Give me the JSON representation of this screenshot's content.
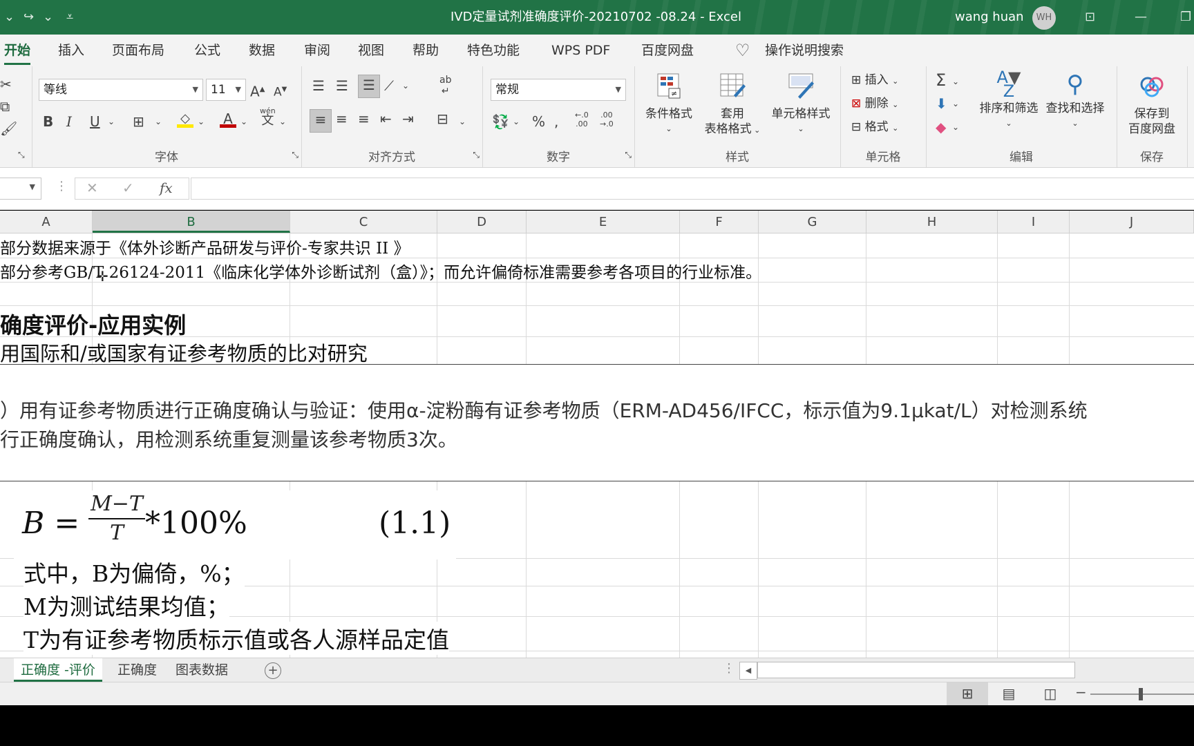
{
  "titlebar": {
    "title": "IVD定量试剂准确度评价-20210702 -08.24  -  Excel",
    "user_name": "wang huan",
    "user_initials": "WH"
  },
  "tabs": [
    "开始",
    "插入",
    "页面布局",
    "公式",
    "数据",
    "审阅",
    "视图",
    "帮助",
    "特色功能",
    "WPS PDF",
    "百度网盘"
  ],
  "tell_me": "操作说明搜索",
  "ribbon": {
    "font": {
      "name": "等线",
      "size": "11",
      "label": "字体",
      "wen_label": "wén"
    },
    "alignment": {
      "label": "对齐方式"
    },
    "number": {
      "format": "常规",
      "label": "数字"
    },
    "styles": {
      "conditional": "条件格式",
      "table_l1": "套用",
      "table_l2": "表格格式",
      "cell_styles": "单元格样式",
      "label": "样式"
    },
    "cells": {
      "insert": "插入",
      "delete": "删除",
      "format": "格式",
      "label": "单元格"
    },
    "editing": {
      "sort": "排序和筛选",
      "find": "查找和选择",
      "label": "编辑"
    },
    "save": {
      "l1": "保存到",
      "l2": "百度网盘",
      "label": "保存"
    }
  },
  "columns": [
    "A",
    "B",
    "C",
    "D",
    "E",
    "F",
    "G",
    "H",
    "I",
    "J"
  ],
  "selected_column": "B",
  "cells": {
    "r1": "部分数据来源于《体外诊断产品研发与评价-专家共识 II 》",
    "r2": "部分参考GB/T 26124-2011《临床化学体外诊断试剂（盒）》；而允许偏倚标准需要参考各项目的行业标准。",
    "r3": "确度评价-应用实例",
    "r4": "用国际和/或国家有证参考物质的比对研究",
    "r5a": "）用有证参考物质进行正确度确认与验证：使用α-淀粉酶有证参考物质（ERM-AD456/IFCC，标示值为9.1μkat/L）对检测系统",
    "r5b": "行正确度确认，用检测系统重复测量该参考物质3次。",
    "formula_lhs": "B =",
    "formula_num": "M−T",
    "formula_den": "T",
    "formula_rhs": "*100%",
    "formula_no": "(1.1)",
    "where1": "式中，B为偏倚，%；",
    "where2": "M为测试结果均值；",
    "where3": "T为有证参考物质标示值或各人源样品定值"
  },
  "sheet_tabs": [
    "正确度 -评价",
    "正确度",
    "图表数据"
  ],
  "active_sheet": "正确度 -评价"
}
